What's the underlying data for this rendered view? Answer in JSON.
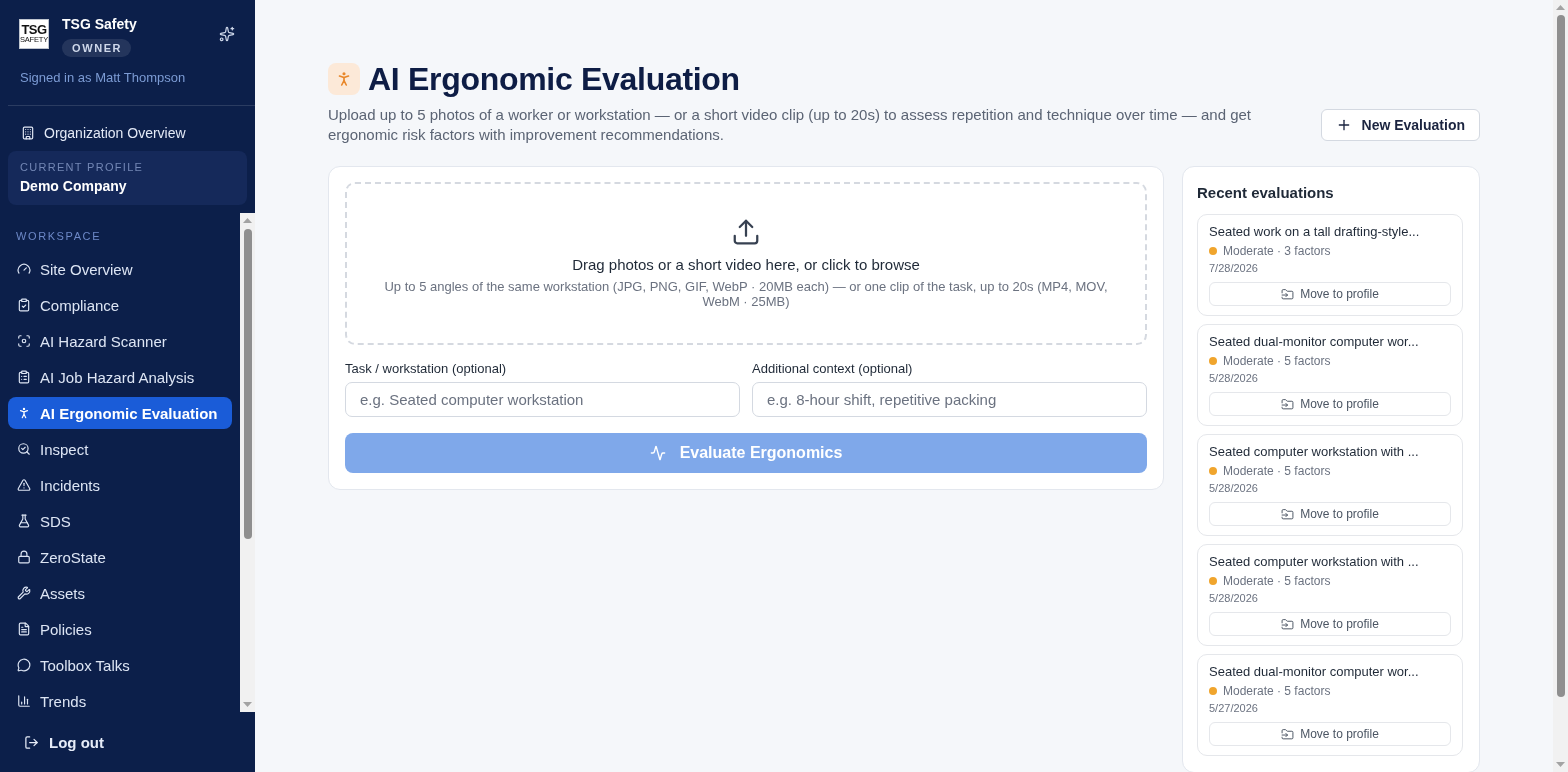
{
  "sidebar": {
    "logo": {
      "line_1": "TSG",
      "line_2": "SAFETY"
    },
    "org_name": "TSG Safety",
    "role_badge": "OWNER",
    "signed_in": "Signed in as Matt Thompson",
    "org_overview": "Organization Overview",
    "current_profile": {
      "label": "CURRENT PROFILE",
      "name": "Demo Company"
    },
    "section_label": "WORKSPACE",
    "items": [
      {
        "label": "Site Overview",
        "selected": false
      },
      {
        "label": "Compliance",
        "selected": false
      },
      {
        "label": "AI Hazard Scanner",
        "selected": false
      },
      {
        "label": "AI Job Hazard Analysis",
        "selected": false
      },
      {
        "label": "AI Ergonomic Evaluation",
        "selected": true
      },
      {
        "label": "Inspect",
        "selected": false
      },
      {
        "label": "Incidents",
        "selected": false
      },
      {
        "label": "SDS",
        "selected": false
      },
      {
        "label": "ZeroState",
        "selected": false
      },
      {
        "label": "Assets",
        "selected": false
      },
      {
        "label": "Policies",
        "selected": false
      },
      {
        "label": "Toolbox Talks",
        "selected": false
      },
      {
        "label": "Trends",
        "selected": false
      }
    ],
    "log_out": "Log out"
  },
  "page": {
    "title": "AI Ergonomic Evaluation",
    "description": "Upload up to 5 photos of a worker or workstation — or a short video clip (up to 20s) to assess repetition and technique over time — and get ergonomic risk factors with improvement recommendations.",
    "new_button": "New Evaluation"
  },
  "upload_card": {
    "dropzone": {
      "title": "Drag photos or a short video here, or click to browse",
      "hint": "Up to 5 angles of the same workstation (JPG, PNG, GIF, WebP · 20MB each) — or one clip of the task, up to 20s (MP4, MOV, WebM · 25MB)"
    },
    "fields": [
      {
        "label": "Task / workstation (optional)",
        "placeholder": "e.g. Seated computer workstation"
      },
      {
        "label": "Additional context (optional)",
        "placeholder": "e.g. 8-hour shift, repetitive packing"
      }
    ],
    "submit": {
      "label": "Evaluate Ergonomics",
      "disabled": true
    }
  },
  "recent": {
    "title": "Recent evaluations",
    "items": [
      {
        "title": "Seated work on a tall drafting-style...",
        "summary": "Moderate · 3 factors",
        "color": "#f0a52d",
        "date": "7/28/2026",
        "action": "Move to profile"
      },
      {
        "title": "Seated dual-monitor computer wor...",
        "summary": "Moderate · 5 factors",
        "color": "#f0a52d",
        "date": "5/28/2026",
        "action": "Move to profile"
      },
      {
        "title": "Seated computer workstation with ...",
        "summary": "Moderate · 5 factors",
        "color": "#f0a52d",
        "date": "5/28/2026",
        "action": "Move to profile"
      },
      {
        "title": "Seated computer workstation with ...",
        "summary": "Moderate · 5 factors",
        "color": "#f0a52d",
        "date": "5/28/2026",
        "action": "Move to profile"
      },
      {
        "title": "Seated dual-monitor computer wor...",
        "summary": "Moderate · 5 factors",
        "color": "#f0a52d",
        "date": "5/27/2026",
        "action": "Move to profile"
      }
    ]
  }
}
